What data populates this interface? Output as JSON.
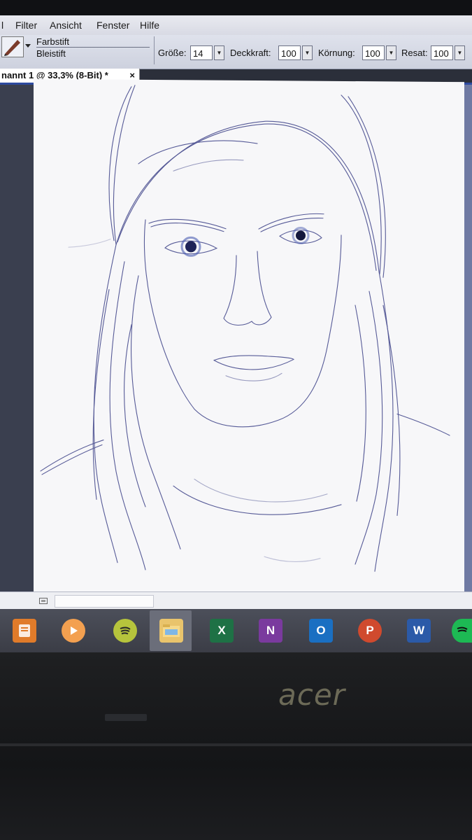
{
  "menu": {
    "items": [
      "l",
      "Filter",
      "Ansicht",
      "Fenster",
      "Hilfe"
    ]
  },
  "toolbar": {
    "tool_group": "Farbstift",
    "tool_name": "Bleistift",
    "size_label": "Größe:",
    "size_value": "14",
    "opacity_label": "Deckkraft:",
    "opacity_value": "100",
    "grain_label": "Körnung:",
    "grain_value": "100",
    "resat_label": "Resat:",
    "resat_value": "100"
  },
  "document": {
    "tab_title": "nannt 1 @ 33,3% (8-Bit) *",
    "close_glyph": "×"
  },
  "taskbar": {
    "apps": [
      {
        "name": "files",
        "color": "#e07b2a"
      },
      {
        "name": "media-player",
        "color": "#f08a3a"
      },
      {
        "name": "spotify",
        "color": "#b3c23a"
      },
      {
        "name": "file-explorer",
        "color": "#e8c46a"
      },
      {
        "name": "excel",
        "letter": "X",
        "color": "#1e7145"
      },
      {
        "name": "onenote",
        "letter": "N",
        "color": "#7a3a9e"
      },
      {
        "name": "outlook",
        "letter": "O",
        "color": "#1a6fc2"
      },
      {
        "name": "powerpoint",
        "letter": "P",
        "color": "#d04a2e"
      },
      {
        "name": "word",
        "letter": "W",
        "color": "#2b5aa8"
      },
      {
        "name": "spotify",
        "color": "#1db954"
      }
    ]
  },
  "hardware": {
    "brand": "acer"
  }
}
